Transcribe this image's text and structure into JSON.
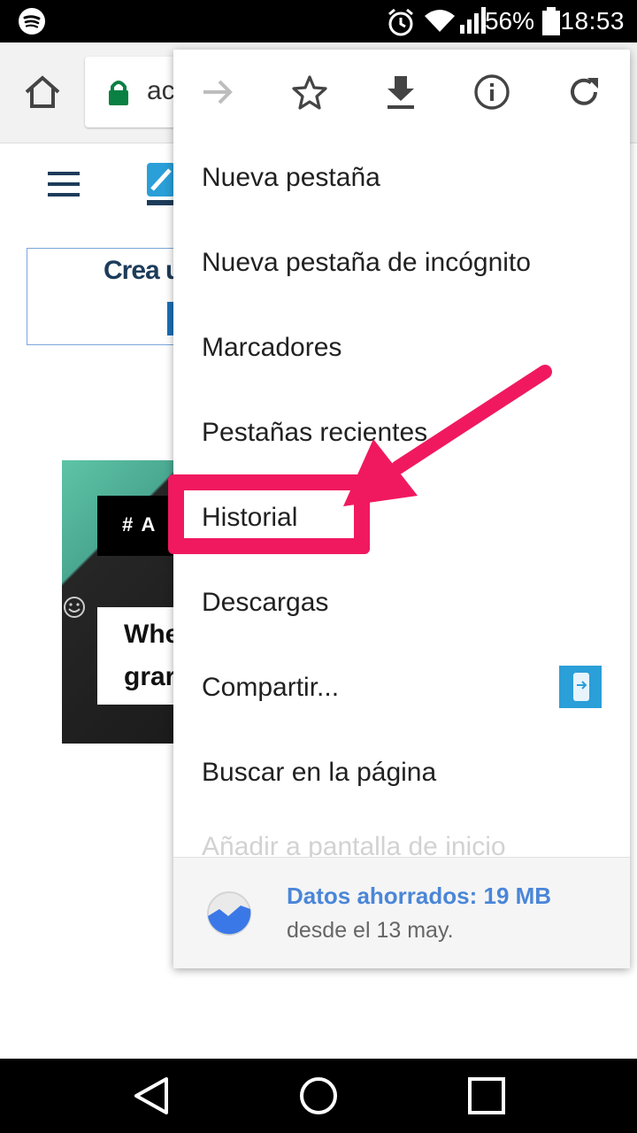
{
  "status_bar": {
    "battery_percent": "56%",
    "time": "18:53",
    "icons": [
      "spotify-icon",
      "alarm-icon",
      "wifi-icon",
      "signal-icon",
      "battery-icon"
    ]
  },
  "toolbar": {
    "url_fragment": "aci",
    "icons": [
      "home-icon",
      "lock-icon"
    ]
  },
  "page": {
    "ad_text": "Crea u",
    "article_tag": "# A",
    "article_title_line1": "Whe",
    "article_title_line2": "grar"
  },
  "menu": {
    "top_icons": [
      "forward-icon",
      "star-icon",
      "download-icon",
      "info-icon",
      "reload-icon"
    ],
    "items": [
      {
        "label": "Nueva pestaña"
      },
      {
        "label": "Nueva pestaña de incógnito"
      },
      {
        "label": "Marcadores"
      },
      {
        "label": "Pestañas recientes"
      },
      {
        "label": "Historial"
      },
      {
        "label": "Descargas"
      },
      {
        "label": "Compartir..."
      },
      {
        "label": "Buscar en la página"
      }
    ],
    "faded_item": "Añadir a pantalla de inicio",
    "footer": {
      "title": "Datos ahorrados: 19 MB",
      "subtitle": "desde el 13 may."
    }
  },
  "annotation": {
    "highlight_color": "#f0195f",
    "highlighted_item": "Historial"
  },
  "nav_bar": {
    "icons": [
      "back-icon",
      "home-circle-icon",
      "recents-icon"
    ]
  }
}
